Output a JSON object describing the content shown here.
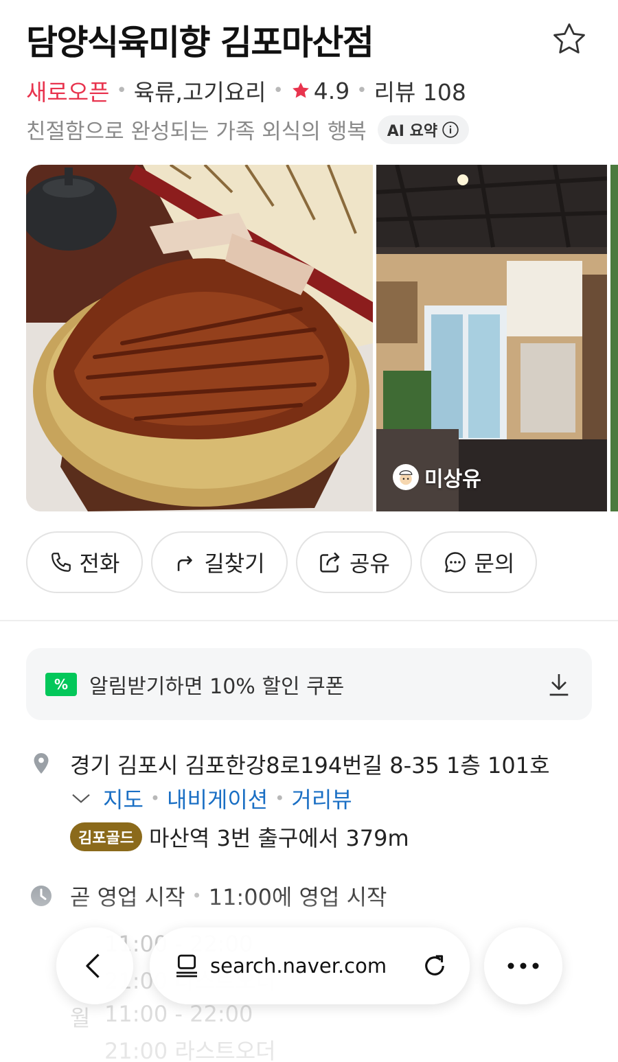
{
  "place": {
    "name": "담양식육미향 김포마산점",
    "status": "새로오픈",
    "category": "육류,고기요리",
    "rating": "4.9",
    "review_label": "리뷰 108",
    "tagline": "친절함으로 완성되는 가족 외식의 행복",
    "ai_label": "AI 요약"
  },
  "photos": {
    "credit": "미상유"
  },
  "actions": [
    {
      "label": "전화",
      "icon": "phone-icon"
    },
    {
      "label": "길찾기",
      "icon": "directions-icon"
    },
    {
      "label": "공유",
      "icon": "share-icon"
    },
    {
      "label": "문의",
      "icon": "chat-icon"
    }
  ],
  "coupon": {
    "badge": "%",
    "text": "알림받기하면 10% 할인 쿠폰"
  },
  "address": {
    "full": "경기 김포시 김포한강8로194번길 8-35 1층 101호",
    "links": [
      "지도",
      "내비게이션",
      "거리뷰"
    ]
  },
  "transit": {
    "badge": "김포골드",
    "text": "마산역 3번 출구에서 379m"
  },
  "hours": {
    "status": "곧 영업 시작",
    "detail": "11:00에 영업 시작",
    "row1": "11:00 - 22:00",
    "row2": "21:00 라스트오더",
    "day": "월",
    "day_hours": "11:00 - 22:00",
    "day_lastorder": "21:00 라스트오더"
  },
  "browser": {
    "url": "search.naver.com"
  },
  "colors": {
    "accent_red": "#e8344e",
    "link_blue": "#1a6fc4",
    "coupon_green": "#03c75a",
    "gold_badge": "#8b6a1b"
  }
}
